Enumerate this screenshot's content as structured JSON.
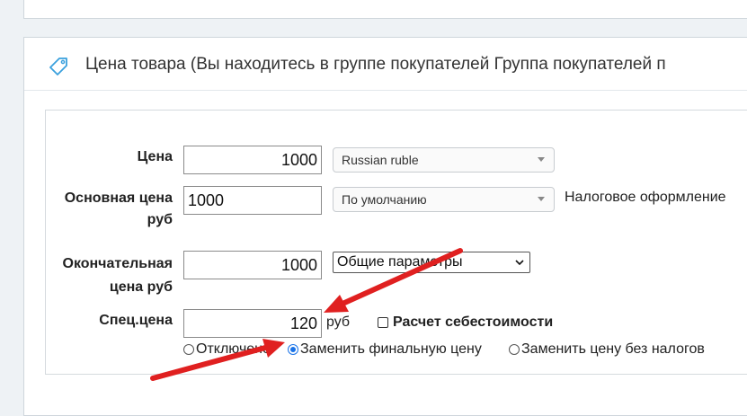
{
  "card": {
    "title": "Цена товара (Вы находитесь в группе покупателей Группа покупателей п"
  },
  "form": {
    "price": {
      "label": "Цена",
      "value": "1000",
      "currency": "Russian ruble"
    },
    "base_price": {
      "label_line1": "Основная цена",
      "label_line2": "руб",
      "value": "1000",
      "option": "По умолчанию",
      "tax_label": "Налоговое оформление"
    },
    "final_price": {
      "label_line1": "Окончательная",
      "label_line2": "цена руб",
      "value": "1000",
      "option": "Общие параметры"
    },
    "special_price": {
      "label": "Спец.цена",
      "value": "120",
      "unit": "руб",
      "cost_calc_label": "Расчет себестоимости",
      "radio_options": [
        "Отключено",
        "Заменить финальную цену",
        "Заменить цену без налогов"
      ],
      "selected_option": "Заменить финальную цену"
    }
  },
  "colors": {
    "accent": "#1a73e8",
    "arrow": "#e02020",
    "tag_icon": "#3aa0dd"
  }
}
